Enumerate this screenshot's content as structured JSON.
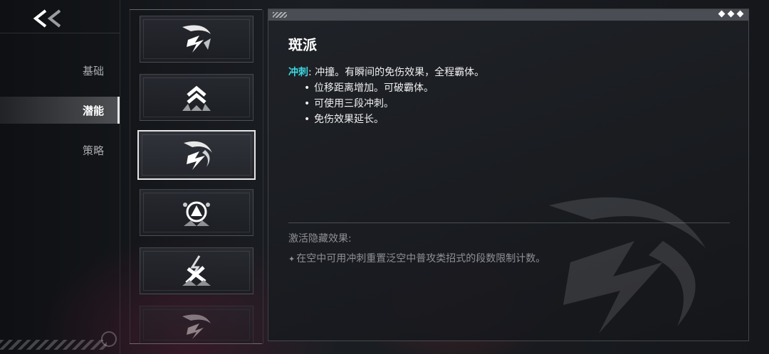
{
  "header": {
    "back_icon": "double-chevron-left-icon"
  },
  "nav": {
    "items": [
      {
        "label": "基础",
        "active": false
      },
      {
        "label": "潜能",
        "active": true
      },
      {
        "label": "策略",
        "active": false
      }
    ]
  },
  "cards": [
    {
      "icon": "slash-dash-icon",
      "selected": false
    },
    {
      "icon": "chevron-rank-icon",
      "selected": false
    },
    {
      "icon": "dash-burst-icon",
      "selected": true
    },
    {
      "icon": "triangle-orb-icon",
      "selected": false
    },
    {
      "icon": "lightning-strike-icon",
      "selected": false
    },
    {
      "icon": "slash-dash-faded-icon",
      "selected": false
    }
  ],
  "detail": {
    "title": "斑派",
    "keyword": "冲刺",
    "colon": ":",
    "summary": " 冲撞。有瞬间的免伤效果，全程霸体。",
    "bullets": [
      "位移距离增加。可破霸体。",
      "可使用三段冲刺。",
      "免伤效果延长。"
    ],
    "hidden_title": "激活隐藏效果:",
    "hidden_star": "✦",
    "hidden_text": "在空中可用冲刺重置泛空中普攻类招式的段数限制计数。"
  },
  "colors": {
    "accent": "#3cd6e0"
  }
}
